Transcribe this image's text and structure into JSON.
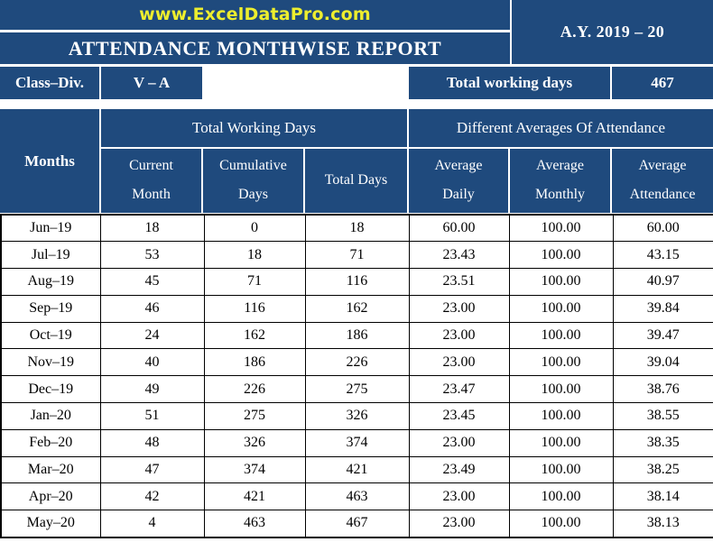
{
  "brand": {
    "url": "www.ExcelDataPro.com",
    "yellow": "#EDEE2E",
    "navy": "#1F4A7D"
  },
  "header": {
    "report_title": "ATTENDANCE MONTHWISE REPORT",
    "academic_year": "A.Y. 2019 – 20"
  },
  "info_row": {
    "class_div_label": "Class–Div.",
    "class_div_value": "V – A",
    "total_working_days_label": "Total working days",
    "total_working_days_value": "467"
  },
  "table": {
    "months_header": "Months",
    "group_headers": {
      "working_days": "Total Working Days",
      "averages": "Different Averages Of Attendance"
    },
    "sub_headers": [
      {
        "line1": "Current",
        "line2": "Month"
      },
      {
        "line1": "Cumulative",
        "line2": "Days"
      },
      {
        "line1": "Total Days",
        "line2": ""
      },
      {
        "line1": "Average",
        "line2": "Daily"
      },
      {
        "line1": "Average",
        "line2": "Monthly"
      },
      {
        "line1": "Average",
        "line2": "Attendance"
      }
    ],
    "rows": [
      {
        "month": "Jun–19",
        "current_month": "18",
        "cumulative_days": "0",
        "total_days": "18",
        "average_daily": "60.00",
        "average_monthly": "100.00",
        "average_attendance": "60.00"
      },
      {
        "month": "Jul–19",
        "current_month": "53",
        "cumulative_days": "18",
        "total_days": "71",
        "average_daily": "23.43",
        "average_monthly": "100.00",
        "average_attendance": "43.15"
      },
      {
        "month": "Aug–19",
        "current_month": "45",
        "cumulative_days": "71",
        "total_days": "116",
        "average_daily": "23.51",
        "average_monthly": "100.00",
        "average_attendance": "40.97"
      },
      {
        "month": "Sep–19",
        "current_month": "46",
        "cumulative_days": "116",
        "total_days": "162",
        "average_daily": "23.00",
        "average_monthly": "100.00",
        "average_attendance": "39.84"
      },
      {
        "month": "Oct–19",
        "current_month": "24",
        "cumulative_days": "162",
        "total_days": "186",
        "average_daily": "23.00",
        "average_monthly": "100.00",
        "average_attendance": "39.47"
      },
      {
        "month": "Nov–19",
        "current_month": "40",
        "cumulative_days": "186",
        "total_days": "226",
        "average_daily": "23.00",
        "average_monthly": "100.00",
        "average_attendance": "39.04"
      },
      {
        "month": "Dec–19",
        "current_month": "49",
        "cumulative_days": "226",
        "total_days": "275",
        "average_daily": "23.47",
        "average_monthly": "100.00",
        "average_attendance": "38.76"
      },
      {
        "month": "Jan–20",
        "current_month": "51",
        "cumulative_days": "275",
        "total_days": "326",
        "average_daily": "23.45",
        "average_monthly": "100.00",
        "average_attendance": "38.55"
      },
      {
        "month": "Feb–20",
        "current_month": "48",
        "cumulative_days": "326",
        "total_days": "374",
        "average_daily": "23.00",
        "average_monthly": "100.00",
        "average_attendance": "38.35"
      },
      {
        "month": "Mar–20",
        "current_month": "47",
        "cumulative_days": "374",
        "total_days": "421",
        "average_daily": "23.49",
        "average_monthly": "100.00",
        "average_attendance": "38.25"
      },
      {
        "month": "Apr–20",
        "current_month": "42",
        "cumulative_days": "421",
        "total_days": "463",
        "average_daily": "23.00",
        "average_monthly": "100.00",
        "average_attendance": "38.14"
      },
      {
        "month": "May–20",
        "current_month": "4",
        "cumulative_days": "463",
        "total_days": "467",
        "average_daily": "23.00",
        "average_monthly": "100.00",
        "average_attendance": "38.13"
      }
    ]
  }
}
